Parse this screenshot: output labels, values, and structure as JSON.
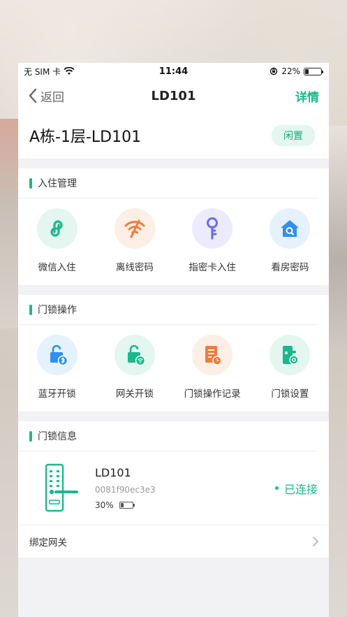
{
  "statusbar": {
    "carrier": "无 SIM 卡",
    "time": "11:44",
    "battery_percent": "22%",
    "battery_level": 0.22
  },
  "navbar": {
    "back_label": "返回",
    "title": "LD101",
    "detail_label": "详情"
  },
  "room": {
    "name": "A栋-1层-LD101",
    "status": "闲置"
  },
  "checkin": {
    "title": "入住管理",
    "items": [
      {
        "label": "微信入住",
        "icon": "wechat-link-icon"
      },
      {
        "label": "离线密码",
        "icon": "offline-wifi-icon"
      },
      {
        "label": "指密卡入住",
        "icon": "key-icon"
      },
      {
        "label": "看房密码",
        "icon": "house-search-icon"
      }
    ]
  },
  "lock_ops": {
    "title": "门锁操作",
    "items": [
      {
        "label": "蓝牙开锁",
        "icon": "bluetooth-lock-icon"
      },
      {
        "label": "网关开锁",
        "icon": "gateway-lock-icon"
      },
      {
        "label": "门锁操作记录",
        "icon": "record-icon"
      },
      {
        "label": "门锁设置",
        "icon": "lock-settings-icon"
      }
    ]
  },
  "lock_info": {
    "title": "门锁信息",
    "name": "LD101",
    "serial": "0081f90ec3e3",
    "battery_percent": "30%",
    "battery_level": 0.3,
    "connection": "已连接",
    "gateway_label": "绑定网关"
  },
  "colors": {
    "accent": "#19b98b"
  }
}
